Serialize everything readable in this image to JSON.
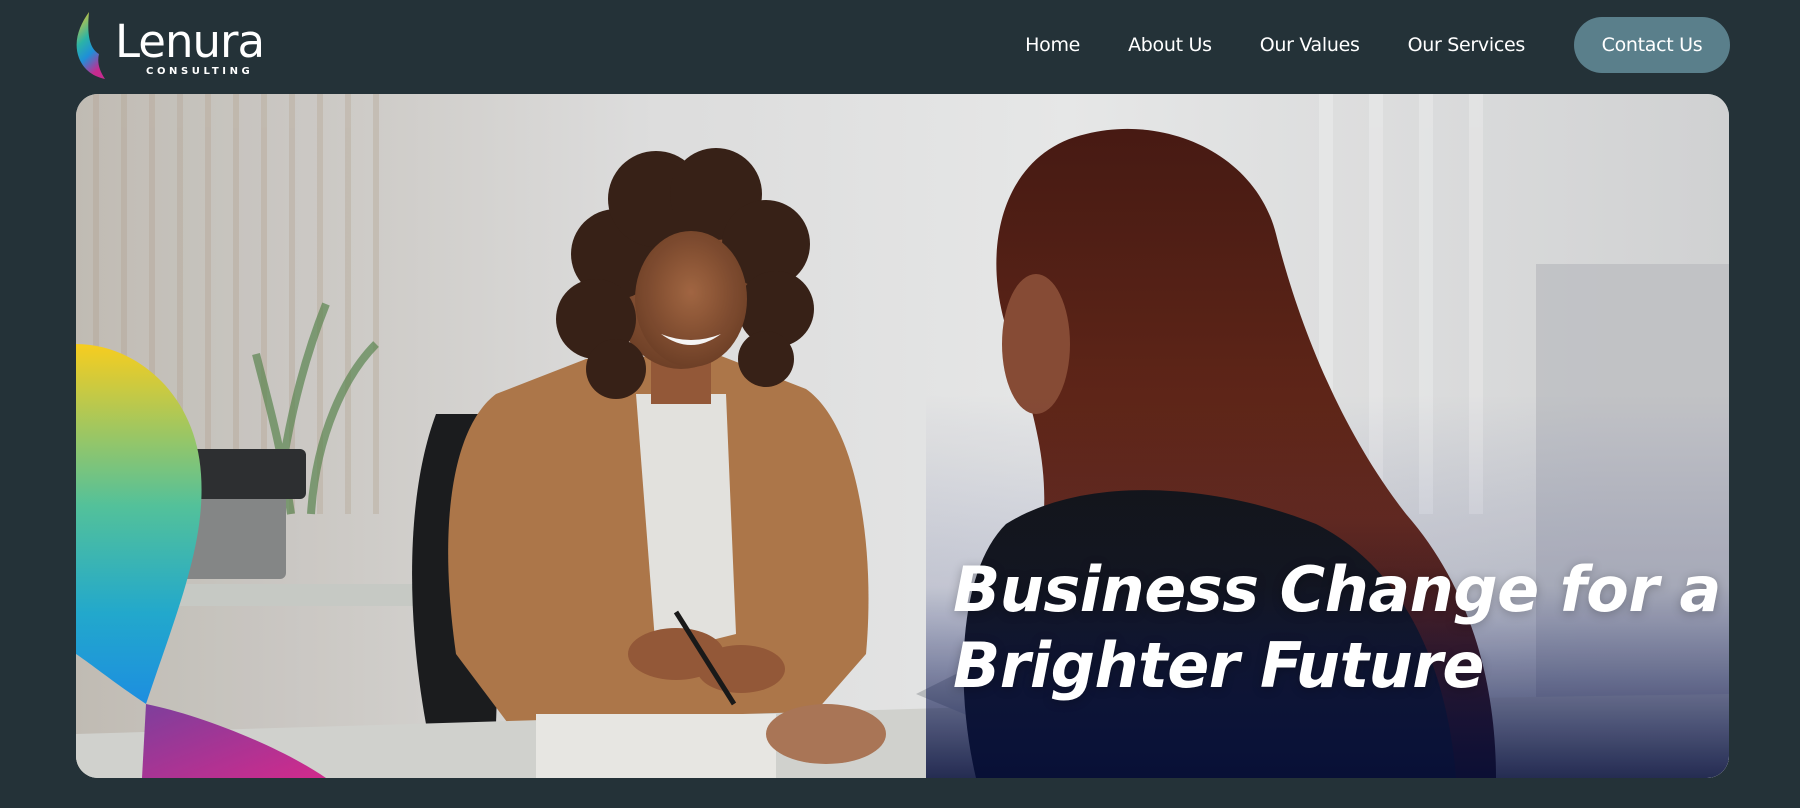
{
  "brand": {
    "name": "Lenura",
    "tagline": "CONSULTING",
    "logo_icon": "leaf-gradient-icon",
    "colors": {
      "yellow": "#f6c823",
      "teal": "#2bb3a6",
      "blue": "#1f8fd8",
      "magenta": "#c62b8f"
    }
  },
  "nav": {
    "items": [
      {
        "label": "Home"
      },
      {
        "label": "About Us"
      },
      {
        "label": "Our Values"
      },
      {
        "label": "Our Services"
      }
    ],
    "cta_label": "Contact Us"
  },
  "hero": {
    "title_line1": "Business Change for a",
    "title_line2": "Brighter Future",
    "image_subject": "two-women-meeting-at-office-desk",
    "overlay_colors": {
      "dark_blue": "#0b1a6e",
      "yellow": "#f7cd1f",
      "magenta": "#b12d95"
    }
  },
  "theme": {
    "background": "#243238",
    "button": "#5a7f8b",
    "text": "#ffffff"
  }
}
